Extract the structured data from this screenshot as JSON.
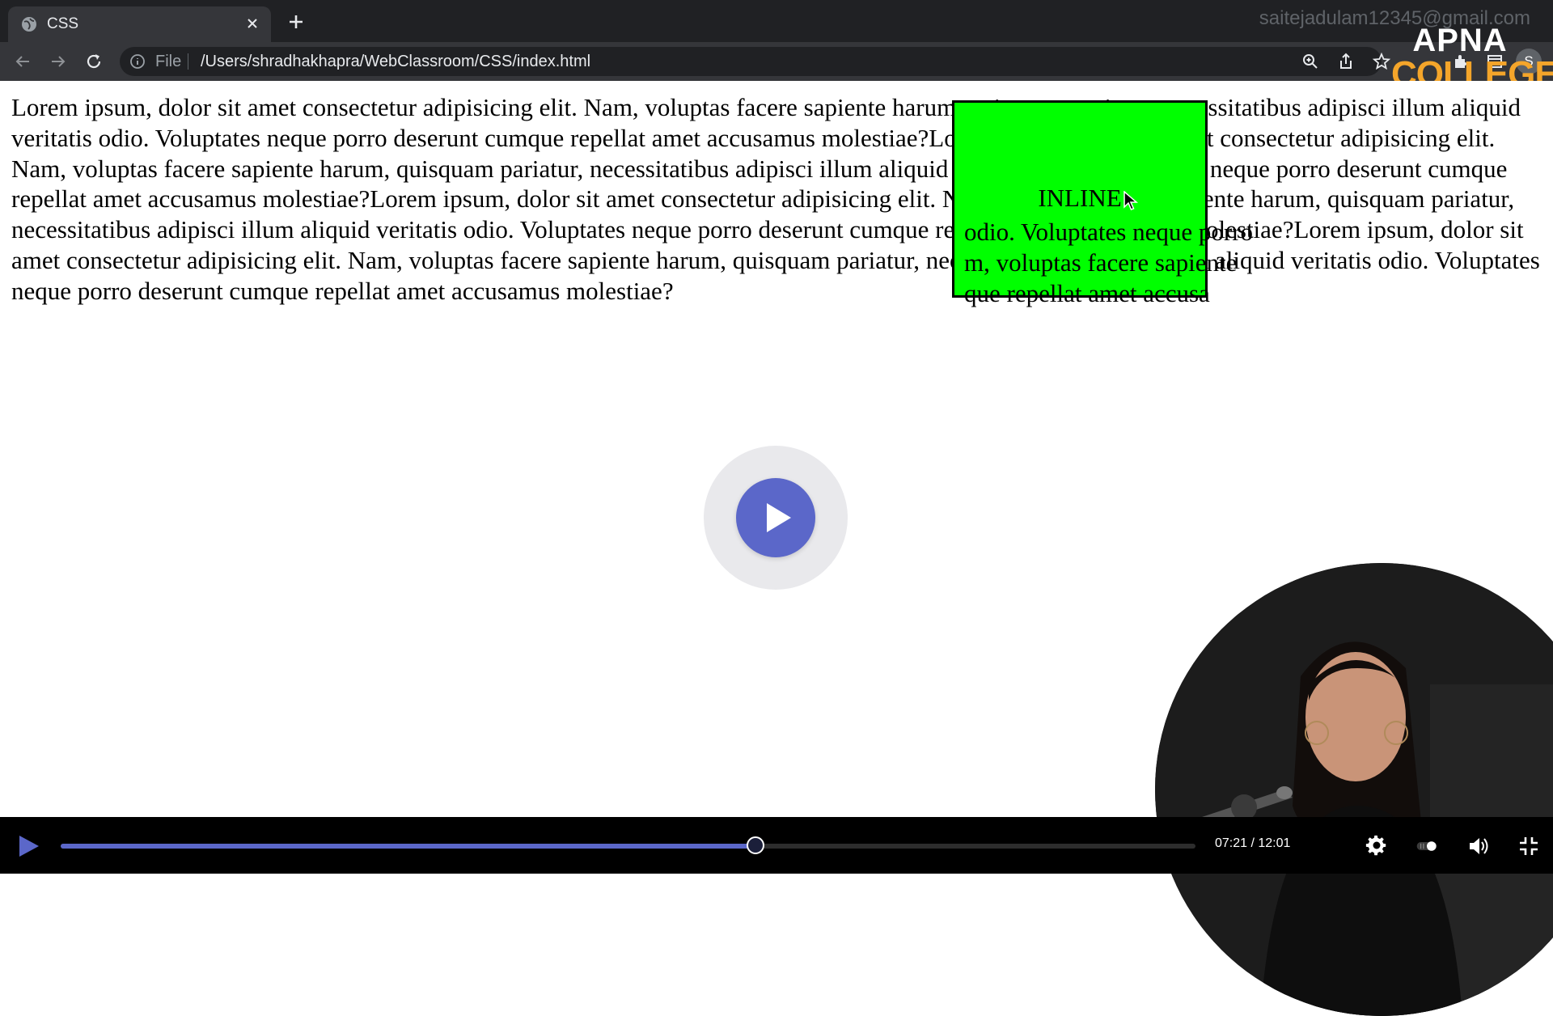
{
  "browser": {
    "tab": {
      "title": "CSS",
      "favicon": "globe-icon",
      "close_icon": "close-icon"
    },
    "new_tab_icon": "plus-icon",
    "account_email": "saitejadulam12345@gmail.com",
    "profile_initial": "S",
    "address_bar": {
      "info_icon": "info-icon",
      "scheme": "File",
      "url": "/Users/shradhakhapra/WebClassroom/CSS/index.html"
    },
    "nav_icons": [
      "back-arrow-icon",
      "forward-arrow-icon",
      "reload-icon"
    ],
    "right_icons": [
      "zoom-icon",
      "share-icon",
      "star-icon",
      "extensions-icon",
      "window-icon"
    ]
  },
  "brand": {
    "line1": "APNA",
    "line2": "COLLEGE",
    "color": "#f4a52a"
  },
  "page": {
    "paragraph": "Lorem ipsum, dolor sit amet consectetur adipisicing elit. Nam, voluptas facere sapiente harum, quisquam pariatur, necessitatibus adipisci illum aliquid veritatis odio. Voluptates neque porro deserunt cumque repellat amet accusamus molestiae?Lorem ipsum, dolor sit amet consectetur adipisicing elit. Nam, voluptas facere sapiente harum, quisquam pariatur, necessitatibus adipisci illum aliquid veritatis odio. Voluptates neque porro deserunt cumque repellat amet accusamus molestiae?Lorem ipsum, dolor sit amet consectetur adipisicing elit. Nam, voluptas facere sapiente harum, quisquam pariatur, necessitatibus adipisci illum aliquid veritatis odio. Voluptates neque porro deserunt cumque repellat amet accusamus molestiae?Lorem ipsum, dolor sit amet consectetur adipisicing elit. Nam, voluptas facere sapiente harum, quisquam pariatur, necessitatibus adipisci illum aliquid veritatis odio. Voluptates neque porro deserunt cumque repellat amet accusamus molestiae?",
    "inline_box": {
      "label": "INLINE",
      "color": "#00ff00"
    },
    "overlap_lines": [
      "odio. Voluptates neque porro",
      "m, voluptas facere sapiente",
      "que repellat amet accusa"
    ]
  },
  "video": {
    "accent": "#5b67c9",
    "current_time": "07:21",
    "duration": "12:01",
    "time_display": "07:21 / 12:01",
    "progress": 0.612,
    "icons": [
      "play-icon",
      "settings-gear-icon",
      "toggle-icon",
      "volume-icon",
      "exit-fullscreen-icon"
    ]
  }
}
